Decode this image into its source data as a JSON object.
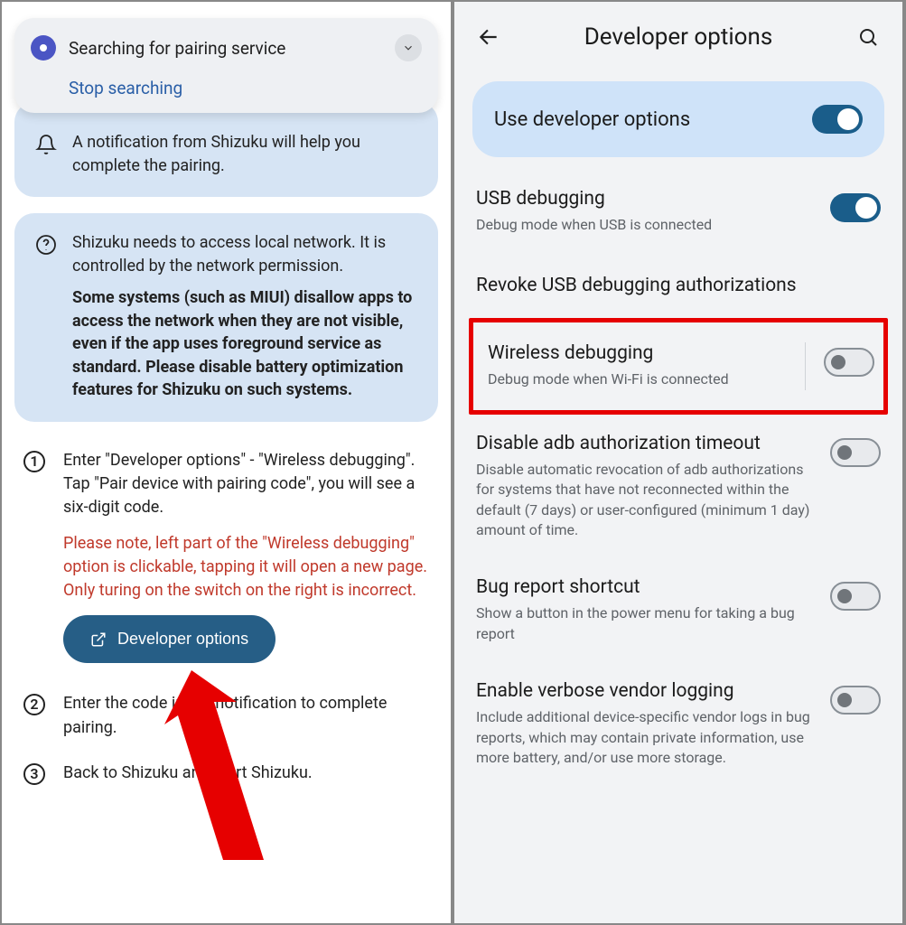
{
  "left": {
    "notification": {
      "title": "Searching for pairing service",
      "action": "Stop searching"
    },
    "tip1": {
      "line1": "A notification from Shizuku will help you",
      "line2": "complete the pairing."
    },
    "tip2": {
      "p1": "Shizuku needs to access local network. It is controlled by the network permission.",
      "p2": "Some systems (such as MIUI) disallow apps to access the network when they are not visible, even if the app uses foreground service as standard. Please disable battery optimization features for Shizuku on such systems."
    },
    "step1": {
      "text": "Enter \"Developer options\" - \"Wireless debugging\". Tap \"Pair device with pairing code\", you will see a six-digit code.",
      "note": "Please note, left part of the \"Wireless debugging\" option is clickable, tapping it will open a new page. Only turing on the switch on the right is incorrect.",
      "button": "Developer options"
    },
    "step2": "Enter the code in the notification to complete pairing.",
    "step3": "Back to Shizuku and start Shizuku."
  },
  "right": {
    "header": "Developer options",
    "master": "Use developer options",
    "usb": {
      "name": "USB debugging",
      "desc": "Debug mode when USB is connected"
    },
    "revoke": "Revoke USB debugging authorizations",
    "wireless": {
      "name": "Wireless debugging",
      "desc": "Debug mode when Wi-Fi is connected"
    },
    "adbTimeout": {
      "name": "Disable adb authorization timeout",
      "desc": "Disable automatic revocation of adb authorizations for systems that have not reconnected within the default (7 days) or user-configured (minimum 1 day) amount of time."
    },
    "bugShortcut": {
      "name": "Bug report shortcut",
      "desc": "Show a button in the power menu for taking a bug report"
    },
    "verbose": {
      "name": "Enable verbose vendor logging",
      "desc": "Include additional device-specific vendor logs in bug reports, which may contain private information, use more battery, and/or use more storage."
    }
  }
}
